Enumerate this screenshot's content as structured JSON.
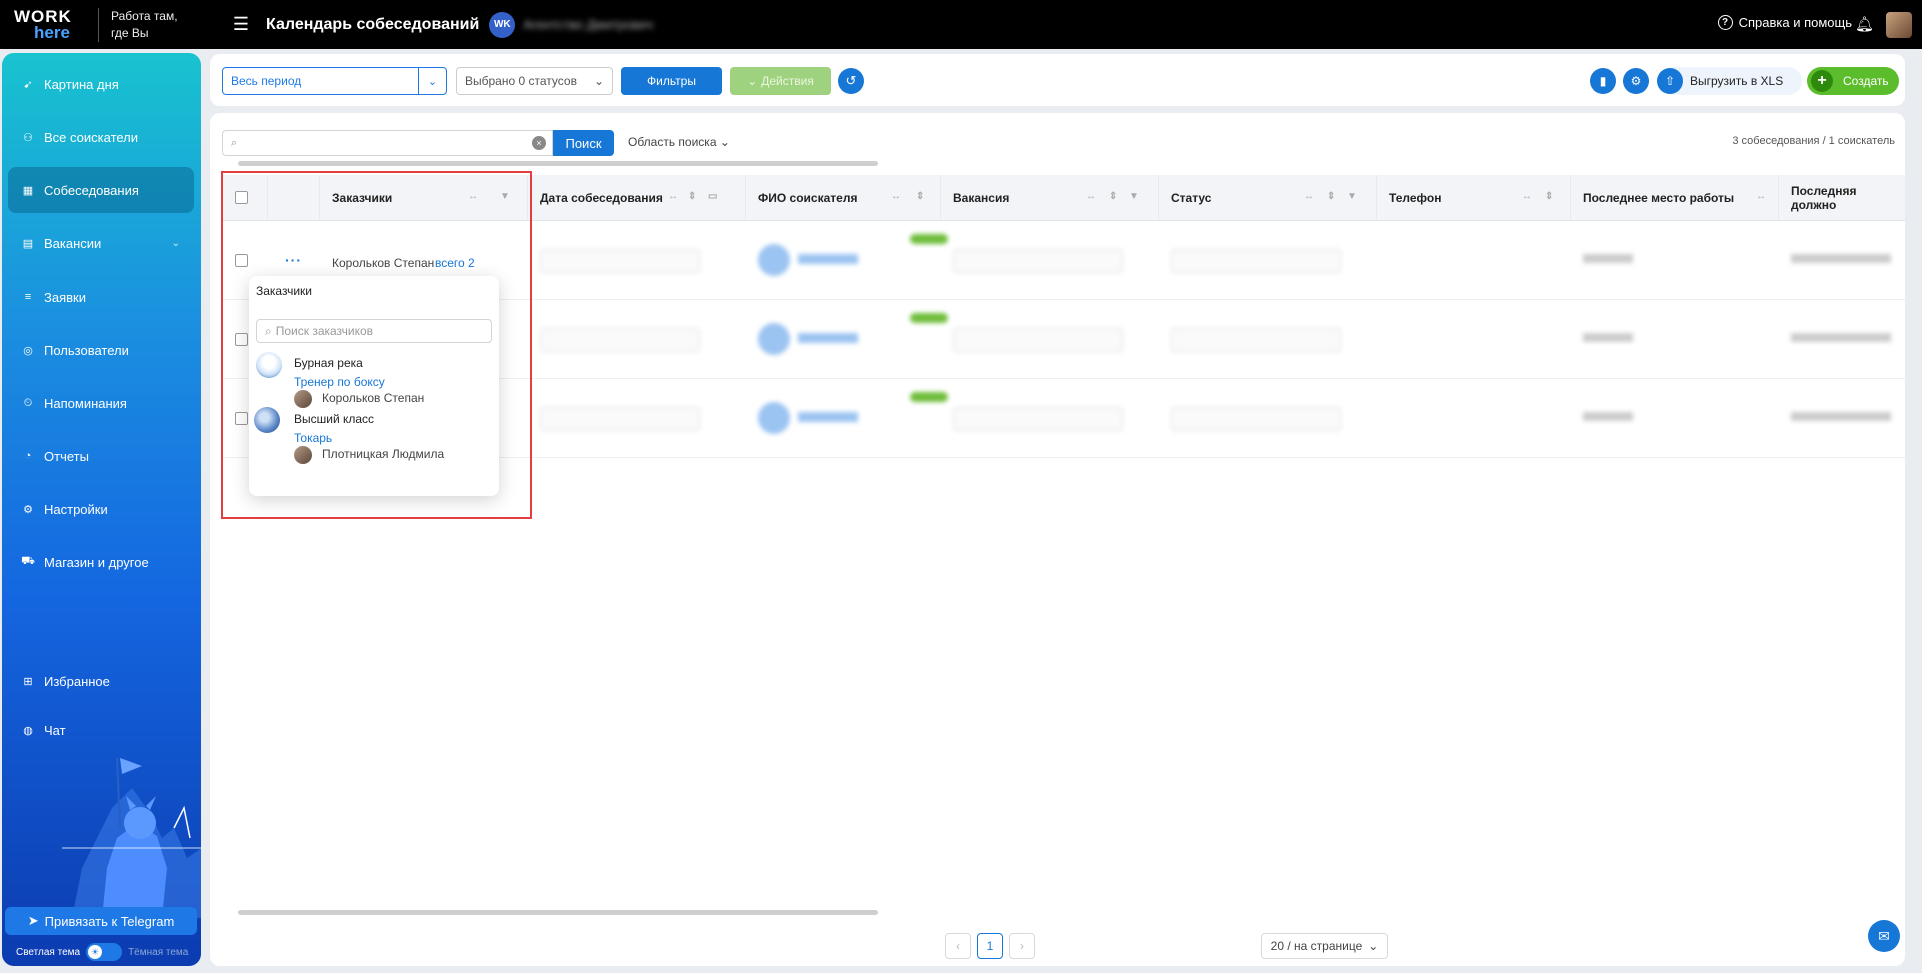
{
  "app": {
    "logo_top": "WORK",
    "logo_bottom": "here",
    "slogan_line1": "Работа там,",
    "slogan_line2": "где Вы",
    "page_title": "Календарь собеседований",
    "org_initials": "WK",
    "org_name": "Агентство Дмитрович",
    "help_label": "Справка и помощь"
  },
  "sidebar": {
    "items": [
      {
        "label": "Картина дня",
        "icon": "rocket-icon"
      },
      {
        "label": "Все соискатели",
        "icon": "users-icon"
      },
      {
        "label": "Собеседования",
        "icon": "calendar-icon"
      },
      {
        "label": "Вакансии",
        "icon": "briefcase-icon"
      },
      {
        "label": "Заявки",
        "icon": "list-icon"
      },
      {
        "label": "Пользователи",
        "icon": "user-icon"
      },
      {
        "label": "Напоминания",
        "icon": "alarm-icon"
      },
      {
        "label": "Отчеты",
        "icon": "pie-chart-icon"
      },
      {
        "label": "Настройки",
        "icon": "gear-icon"
      },
      {
        "label": "Магазин и другое",
        "icon": "cart-icon"
      },
      {
        "label": "Избранное",
        "icon": "grid-icon"
      },
      {
        "label": "Чат",
        "icon": "chat-icon"
      }
    ],
    "active_index": 2,
    "telegram_label": "Привязать к Telegram",
    "theme_light": "Светлая тема",
    "theme_dark": "Тёмная тема"
  },
  "toolbar": {
    "period": "Весь период",
    "statuses": "Выбрано 0 статусов",
    "filters": "Фильтры",
    "actions": "Действия",
    "export": "Выгрузить в XLS",
    "create": "Создать"
  },
  "search": {
    "placeholder": "",
    "button": "Поиск",
    "scope": "Область поиска",
    "counts": "3 собеседования / 1 соискатель"
  },
  "table": {
    "columns": [
      "Заказчики",
      "Дата собеседования",
      "ФИО соискателя",
      "Вакансия",
      "Статус",
      "Телефон",
      "Последнее место работы",
      "Последняя должно"
    ],
    "first_row": {
      "customer": "Корольков Степан",
      "total": "всего 2"
    }
  },
  "popover": {
    "title": "Заказчики",
    "search_placeholder": "Поиск заказчиков",
    "entries": [
      {
        "company": "Бурная река",
        "vacancy": "Тренер по боксу",
        "person": "Корольков Степан"
      },
      {
        "company": "Высший класс",
        "vacancy": "Токарь",
        "person": "Плотницкая Людмила"
      }
    ]
  },
  "pagination": {
    "current": "1",
    "page_size": "20 / на странице"
  },
  "colors": {
    "accent": "#1677d6",
    "create": "#5cbd2c",
    "highlight": "#e24040"
  }
}
